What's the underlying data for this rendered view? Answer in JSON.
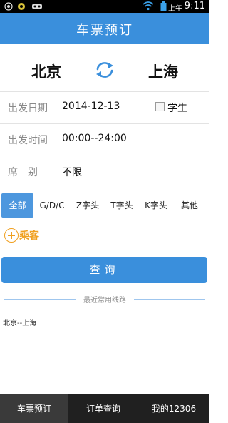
{
  "status_bar": {
    "ampm": "上午",
    "time": "9:11",
    "icons": [
      "notification-icon",
      "sync-icon",
      "wifi-icon",
      "battery-icon"
    ]
  },
  "header": {
    "title": "车票预订"
  },
  "stations": {
    "from": "北京",
    "to": "上海",
    "swap_icon": "swap-arrows-icon"
  },
  "form": {
    "date_label": "出发日期",
    "date_value": "2014-12-13",
    "student_label": "学生",
    "student_checked": false,
    "time_label": "出发时间",
    "time_value": "00:00--24:00",
    "seat_label": "席　别",
    "seat_value": "不限"
  },
  "train_types": {
    "tabs": [
      "全部",
      "G/D/C",
      "Z字头",
      "T字头",
      "K字头",
      "其他"
    ],
    "active_index": 0
  },
  "passenger": {
    "label": "乘客",
    "icon": "add-circle-icon"
  },
  "query_button": {
    "label": "查询"
  },
  "recent": {
    "title": "最近常用线路",
    "routes": [
      "北京--上海"
    ]
  },
  "bottom_nav": {
    "items": [
      "车票预订",
      "订单查询",
      "我的12306"
    ],
    "active_index": 0
  },
  "colors": {
    "primary": "#3a8fdc",
    "accent": "#f0a020",
    "nav_bg": "#202020"
  }
}
